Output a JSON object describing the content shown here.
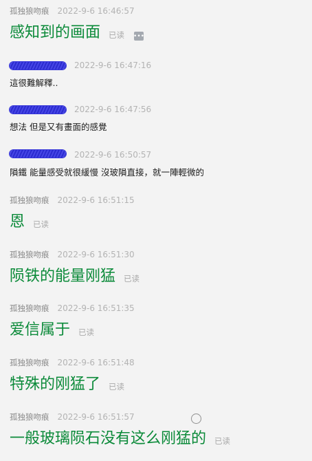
{
  "messages": [
    {
      "sender": "孤独狼吻痕",
      "time": "2022-9-6 16:46:57",
      "text": "感知到的画面",
      "read": "已读",
      "more": "•••"
    },
    {
      "sender": "",
      "time": "2022-9-6 16:47:16",
      "text": "這很難解釋.."
    },
    {
      "sender": "",
      "time": "2022-9-6 16:47:56",
      "text": "想法 但是又有畫面的感覺"
    },
    {
      "sender": "",
      "time": "2022-9-6 16:50:57",
      "text": "隕鐵 能量感受就很緩慢 沒玻隕直接，就一陣輕微的"
    },
    {
      "sender": "孤独狼吻痕",
      "time": "2022-9-6 16:51:15",
      "text": "恩",
      "read": "已读"
    },
    {
      "sender": "孤独狼吻痕",
      "time": "2022-9-6 16:51:30",
      "text": "陨铁的能量刚猛",
      "read": "已读"
    },
    {
      "sender": "孤独狼吻痕",
      "time": "2022-9-6 16:51:35",
      "text": "爱信属于",
      "read": "已读"
    },
    {
      "sender": "孤独狼吻痕",
      "time": "2022-9-6 16:51:48",
      "text": "特殊的刚猛了",
      "read": "已读"
    },
    {
      "sender": "孤独狼吻痕",
      "time": "2022-9-6 16:51:57",
      "text": "一般玻璃陨石没有这么刚猛的",
      "read": "已读"
    }
  ],
  "colors": {
    "background": "#f3f3f3",
    "self_text": "#0b8a39",
    "other_text": "#1c1c1c",
    "meta": "#8a8a8a",
    "redaction": "#3535d8"
  },
  "icons": {
    "more": "ellipsis-icon",
    "circle": "circle-icon"
  }
}
